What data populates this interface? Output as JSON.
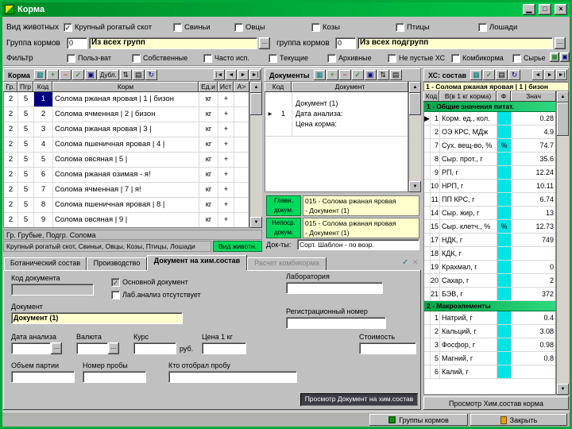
{
  "window": {
    "title": "Корма",
    "btn_min": "▁",
    "btn_max": "□",
    "btn_close": "×"
  },
  "icons": {
    "grid": "▦",
    "add": "+",
    "remove": "−",
    "confirm": "✓",
    "copy": "▣",
    "dupl": "Дубл.",
    "sort": "⇅",
    "print": "▤",
    "refresh": "↻",
    "first": "|◄",
    "prev": "◄",
    "next": "►",
    "last": "►|",
    "more": "...",
    "up": "▲",
    "down": "▼",
    "check": "✓",
    "marker": "▶",
    "cross": "✕",
    "dropdown": "▼"
  },
  "animals": {
    "label": "Вид животных",
    "items": [
      {
        "label": "Крупный рогатый скот",
        "checked": true
      },
      {
        "label": "Свиньи",
        "checked": false
      },
      {
        "label": "Овцы",
        "checked": false
      },
      {
        "label": "Козы",
        "checked": false
      },
      {
        "label": "Птицы",
        "checked": false
      },
      {
        "label": "Лошади",
        "checked": false
      }
    ]
  },
  "groups": {
    "label": "Группа кормов",
    "code": "0",
    "name": "Из всех групп",
    "sub_label": "группа кормов",
    "sub_code": "0",
    "sub_name": "Из всех подгрупп"
  },
  "filter": {
    "label": "Фильтр",
    "items": [
      "Польз-ват",
      "Собственные",
      "Часто исп.",
      "Текущие",
      "Архивные",
      "Не пустые ХС",
      "Комбикорма",
      "Сырье"
    ]
  },
  "feeds": {
    "toolbar_label": "Корма",
    "columns": [
      "Гр.",
      "Пгр",
      "Код",
      "Корм",
      "Ед.и",
      "Ист",
      "А>"
    ],
    "rows": [
      {
        "gr": "2",
        "pgr": "5",
        "kod": "1",
        "name": "Солома ржаная яровая | 1 | бизон",
        "ed": "кг",
        "ist": "+",
        "sel": true
      },
      {
        "gr": "2",
        "pgr": "5",
        "kod": "2",
        "name": "Солома ячменная | 2 | бизон",
        "ed": "кг",
        "ist": "+"
      },
      {
        "gr": "2",
        "pgr": "5",
        "kod": "3",
        "name": "Солома ржаная яровая | 3 |",
        "ed": "кг",
        "ist": "+"
      },
      {
        "gr": "2",
        "pgr": "5",
        "kod": "4",
        "name": "Солома пшеничная яровая | 4 |",
        "ed": "кг",
        "ist": "+"
      },
      {
        "gr": "2",
        "pgr": "5",
        "kod": "5",
        "name": "Солома овсяная | 5 |",
        "ed": "кг",
        "ist": "+"
      },
      {
        "gr": "2",
        "pgr": "5",
        "kod": "6",
        "name": "Солома ржаная озимая - я!",
        "ed": "кг",
        "ist": "+"
      },
      {
        "gr": "2",
        "pgr": "5",
        "kod": "7",
        "name": "Солома ячменная | 7 | я!",
        "ed": "кг",
        "ist": "+"
      },
      {
        "gr": "2",
        "pgr": "5",
        "kod": "8",
        "name": "Солома пшеничная яровая | 8 |",
        "ed": "кг",
        "ist": "+"
      },
      {
        "gr": "2",
        "pgr": "5",
        "kod": "9",
        "name": "Солома овсяная | 9 |",
        "ed": "кг",
        "ist": "+"
      }
    ],
    "footer_group": "Гр. Грубые, Подгр. Солома",
    "footer_animals": "Крупный рогатый скот, Свиньи, Овцы, Козы, Птицы, Лошади",
    "badge": "Вид животн."
  },
  "documents": {
    "toolbar_label": "Документы",
    "columns": [
      "Код",
      "Документ"
    ],
    "row": {
      "kod": "1",
      "line1": "Документ (1)",
      "line2": "Дата анализа:",
      "line3": "Цена корма:"
    },
    "main_label": "Главн. докум.",
    "main_line1": "015 - Солома ржаная яровая",
    "main_line2": "- Документ (1)",
    "direct_label": "Непоср. докум.",
    "direct_line1": "015 - Солома ржаная яровая",
    "direct_line2": "- Документ (1)",
    "sort_label": "Док-ты:",
    "sort_value": "Сорт. Шаблон - по возр."
  },
  "chem": {
    "toolbar_label": "ХС: состав",
    "title": "1 - Солома ржаная яровая | 1 | бизон",
    "columns": [
      "Код",
      "В(в 1 кг корма)",
      "Ф",
      "Знач"
    ],
    "section1": "1 - Общие значения питат.",
    "rows1": [
      {
        "mark": "▶",
        "kod": "1",
        "name": "Корм. ед., кол.",
        "f": "",
        "val": "0.28"
      },
      {
        "mark": "",
        "kod": "2",
        "name": "ОЭ КРС, МДж",
        "f": "",
        "val": "4.9"
      },
      {
        "mark": "",
        "kod": "7",
        "name": "Сух. вещ-во, %",
        "f": "%",
        "val": "74.7"
      },
      {
        "mark": "",
        "kod": "8",
        "name": "Сыр. прот., г",
        "f": "",
        "val": "35.6"
      },
      {
        "mark": "",
        "kod": "9",
        "name": "РП, г",
        "f": "",
        "val": "12.24"
      },
      {
        "mark": "",
        "kod": "10",
        "name": "НРП, г",
        "f": "",
        "val": "10.11"
      },
      {
        "mark": "",
        "kod": "11",
        "name": "ПП КРС, г",
        "f": "",
        "val": "6.74"
      },
      {
        "mark": "",
        "kod": "14",
        "name": "Сыр. жир, г",
        "f": "",
        "val": "13"
      },
      {
        "mark": "",
        "kod": "15",
        "name": "Сыр. клетч., %",
        "f": "%",
        "val": "12.73"
      },
      {
        "mark": "",
        "kod": "17",
        "name": "НДК, г",
        "f": "",
        "val": "749"
      },
      {
        "mark": "",
        "kod": "18",
        "name": "КДК, г",
        "f": "",
        "val": ""
      },
      {
        "mark": "",
        "kod": "19",
        "name": "Крахмал, г",
        "f": "",
        "val": "0"
      },
      {
        "mark": "",
        "kod": "20",
        "name": "Сахар, г",
        "f": "",
        "val": "2"
      },
      {
        "mark": "",
        "kod": "21",
        "name": "БЭВ, г",
        "f": "",
        "val": "372"
      }
    ],
    "section2": "2 - Макроэлементы",
    "rows2": [
      {
        "mark": "",
        "kod": "1",
        "name": "Натрий, г",
        "f": "",
        "val": "0.4"
      },
      {
        "mark": "",
        "kod": "2",
        "name": "Кальций, г",
        "f": "",
        "val": "3.08"
      },
      {
        "mark": "",
        "kod": "3",
        "name": "Фосфор, г",
        "f": "",
        "val": "0.98"
      },
      {
        "mark": "",
        "kod": "5",
        "name": "Магний, г",
        "f": "",
        "val": "0.8"
      },
      {
        "mark": "",
        "kod": "6",
        "name": "Калий, г",
        "f": "",
        "val": ""
      }
    ],
    "view_button": "Просмотр Хим.состав корма"
  },
  "tabs": {
    "items": [
      {
        "label": "Ботанический состав"
      },
      {
        "label": "Производство"
      },
      {
        "label": "Документ на хим.состав"
      },
      {
        "label": "Расчет комбикорма"
      }
    ]
  },
  "form": {
    "doc_code_label": "Код документа",
    "main_doc_label": "Основной документ",
    "no_lab_label": "Лаб.анализ отсутствует",
    "lab_label": "Лаборатория",
    "document_label": "Документ",
    "document_value": "Документ (1)",
    "reg_label": "Регистрационный номер",
    "date_label": "Дата анализа",
    "currency_label": "Валюта",
    "rate_label": "Курс",
    "rub_label": "руб.",
    "price_label": "Цена 1 кг",
    "cost_label": "Стоимость",
    "batch_label": "Объем партии",
    "sample_label": "Номер пробы",
    "sampler_label": "Кто отобрал пробу",
    "view_button": "Просмотр Документ на хим.состав"
  },
  "bottom": {
    "groups_button": "Группы кормов",
    "close_button": "Закрыть"
  }
}
